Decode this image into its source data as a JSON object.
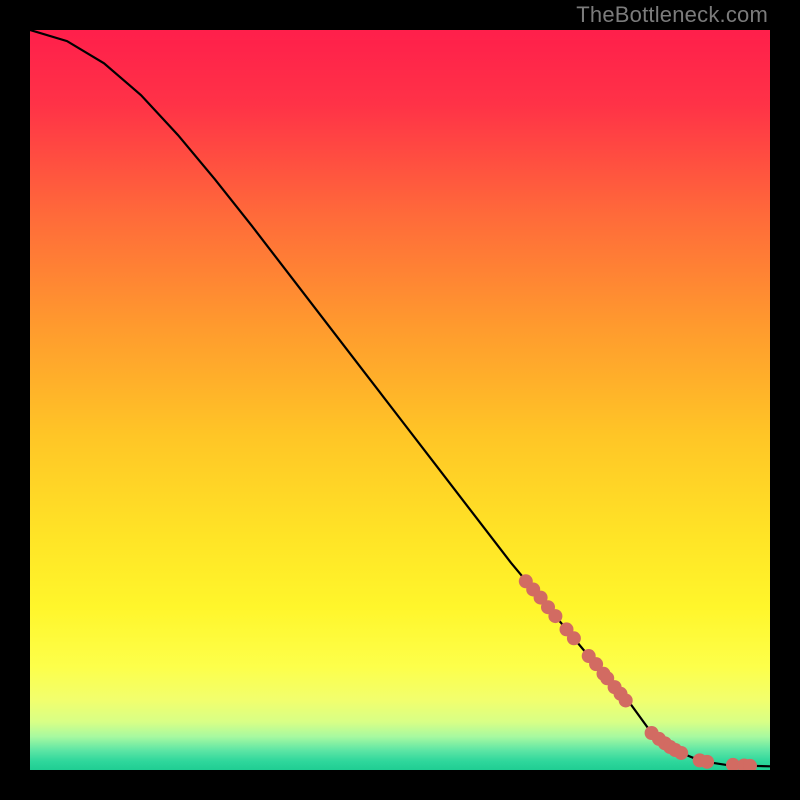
{
  "watermark": "TheBottleneck.com",
  "chart_data": {
    "type": "line",
    "title": "",
    "xlabel": "",
    "ylabel": "",
    "xlim": [
      0,
      100
    ],
    "ylim": [
      0,
      100
    ],
    "curve": {
      "name": "bottleneck-curve",
      "x": [
        0,
        5,
        10,
        15,
        20,
        25,
        30,
        35,
        40,
        45,
        50,
        55,
        60,
        65,
        70,
        75,
        80,
        84,
        86,
        88,
        90,
        92,
        94,
        96,
        98,
        100
      ],
      "y": [
        100,
        98.5,
        95.5,
        91.2,
        85.8,
        79.8,
        73.5,
        67.0,
        60.5,
        54.0,
        47.5,
        41.0,
        34.5,
        28.0,
        22.0,
        16.0,
        10.5,
        5.0,
        3.5,
        2.3,
        1.5,
        1.0,
        0.7,
        0.6,
        0.55,
        0.5
      ]
    },
    "markers": {
      "name": "highlight-points",
      "color": "#d26b62",
      "radius_px": 7,
      "x": [
        67,
        68,
        69,
        70,
        71,
        72.5,
        73.5,
        75.5,
        76.5,
        77.5,
        78,
        79,
        79.8,
        80.5,
        84,
        85,
        85.8,
        86.5,
        87.2,
        88,
        90.5,
        91.5,
        95,
        96.5,
        97.3
      ],
      "y": [
        25.5,
        24.4,
        23.3,
        22.0,
        20.8,
        19.0,
        17.8,
        15.4,
        14.3,
        13.0,
        12.4,
        11.2,
        10.3,
        9.4,
        5.0,
        4.2,
        3.6,
        3.1,
        2.7,
        2.3,
        1.3,
        1.1,
        0.7,
        0.6,
        0.55
      ]
    },
    "gradient_stops": [
      {
        "offset": 0.0,
        "color": "#ff1f4b"
      },
      {
        "offset": 0.1,
        "color": "#ff3247"
      },
      {
        "offset": 0.25,
        "color": "#ff6a3a"
      },
      {
        "offset": 0.4,
        "color": "#ff9a2e"
      },
      {
        "offset": 0.55,
        "color": "#ffc626"
      },
      {
        "offset": 0.68,
        "color": "#ffe326"
      },
      {
        "offset": 0.78,
        "color": "#fff62b"
      },
      {
        "offset": 0.86,
        "color": "#fdff4a"
      },
      {
        "offset": 0.905,
        "color": "#f2ff6d"
      },
      {
        "offset": 0.935,
        "color": "#d8ff86"
      },
      {
        "offset": 0.955,
        "color": "#a7f9a0"
      },
      {
        "offset": 0.973,
        "color": "#5fe6a5"
      },
      {
        "offset": 0.988,
        "color": "#2fd79c"
      },
      {
        "offset": 1.0,
        "color": "#1fce93"
      }
    ]
  }
}
